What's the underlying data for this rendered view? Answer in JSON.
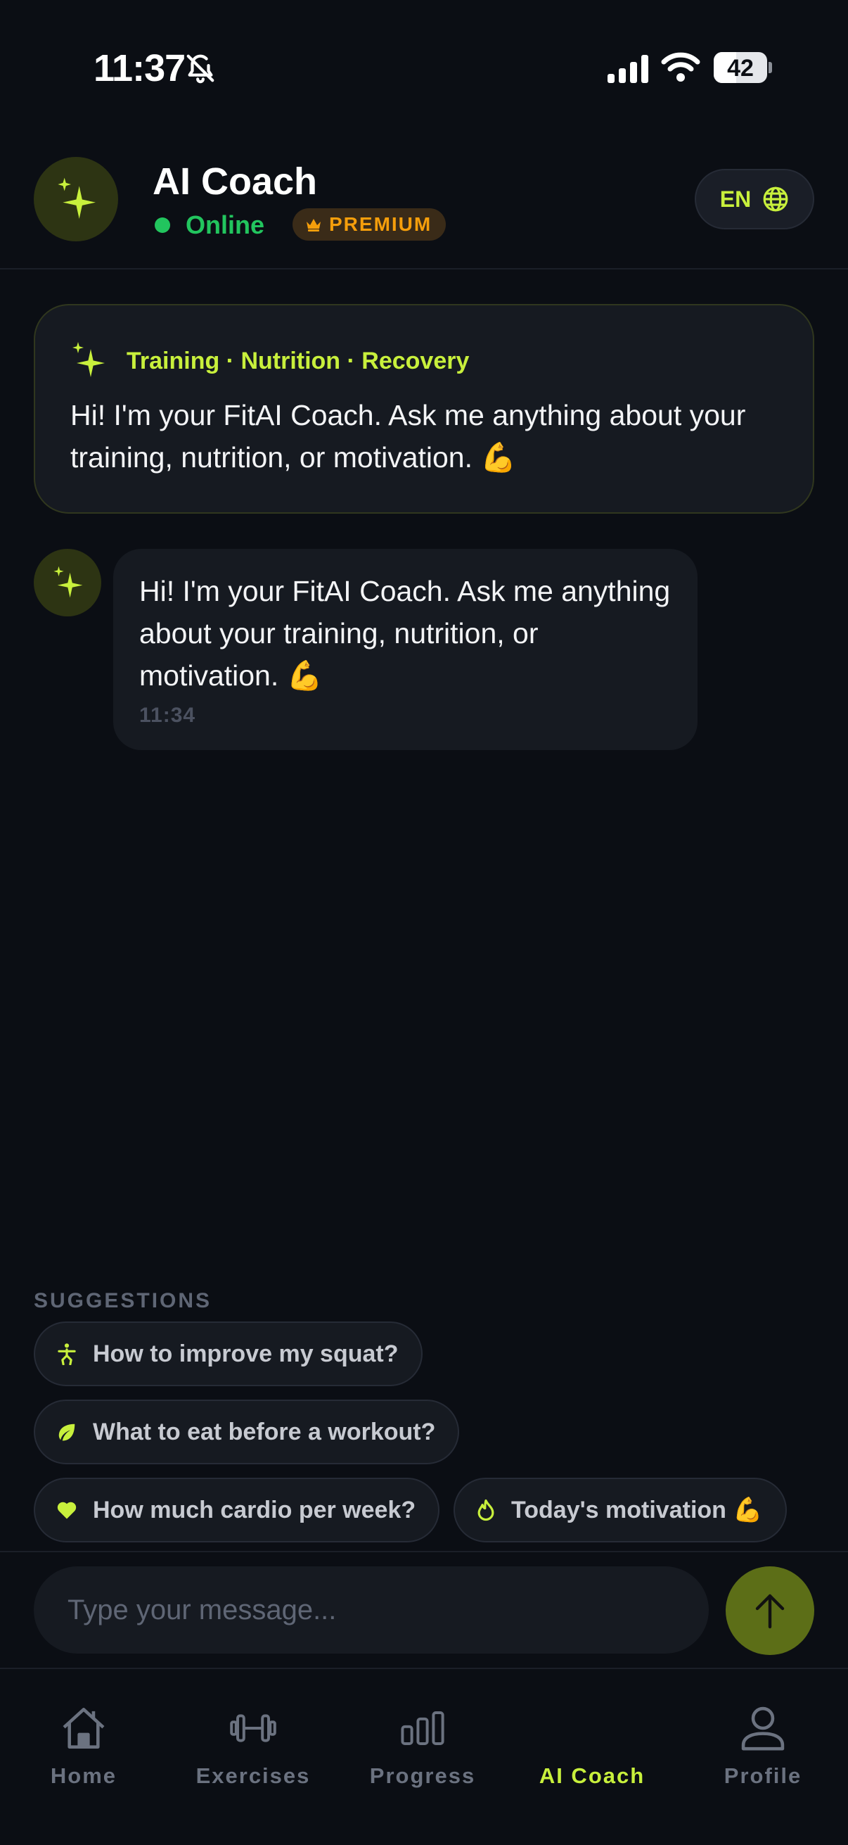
{
  "status_bar": {
    "time": "11:37",
    "battery": "42",
    "battery_level": 0.42
  },
  "header": {
    "title": "AI Coach",
    "status": "Online",
    "badge": "PREMIUM",
    "language": "EN"
  },
  "intro_card": {
    "tags": "Training · Nutrition · Recovery",
    "text": "Hi! I'm your FitAI Coach. Ask me anything about your training, nutrition, or motivation. 💪"
  },
  "messages": [
    {
      "sender": "coach",
      "text": "Hi! I'm your FitAI Coach. Ask me anything about your training, nutrition, or motivation. 💪",
      "time": "11:34"
    }
  ],
  "suggestions": {
    "title": "SUGGESTIONS",
    "items": [
      {
        "label": "How to improve my squat?",
        "icon": "figure-icon"
      },
      {
        "label": "What to eat before a workout?",
        "icon": "leaf-icon"
      },
      {
        "label": "How much cardio per week?",
        "icon": "heart-icon"
      },
      {
        "label": "Today's motivation 💪",
        "icon": "flame-icon"
      }
    ]
  },
  "input": {
    "placeholder": "Type your message..."
  },
  "nav": {
    "items": [
      {
        "label": "Home",
        "icon": "home-icon",
        "active": false
      },
      {
        "label": "Exercises",
        "icon": "dumbbell-icon",
        "active": false
      },
      {
        "label": "Progress",
        "icon": "bar-chart-icon",
        "active": false
      },
      {
        "label": "AI Coach",
        "icon": "sparkle-icon",
        "active": true
      },
      {
        "label": "Profile",
        "icon": "person-icon",
        "active": false
      }
    ]
  },
  "colors": {
    "accent": "#c8f03c",
    "background": "#0b0e14",
    "card": "#161a21",
    "online": "#22c55e",
    "premium": "#f59e0b"
  }
}
